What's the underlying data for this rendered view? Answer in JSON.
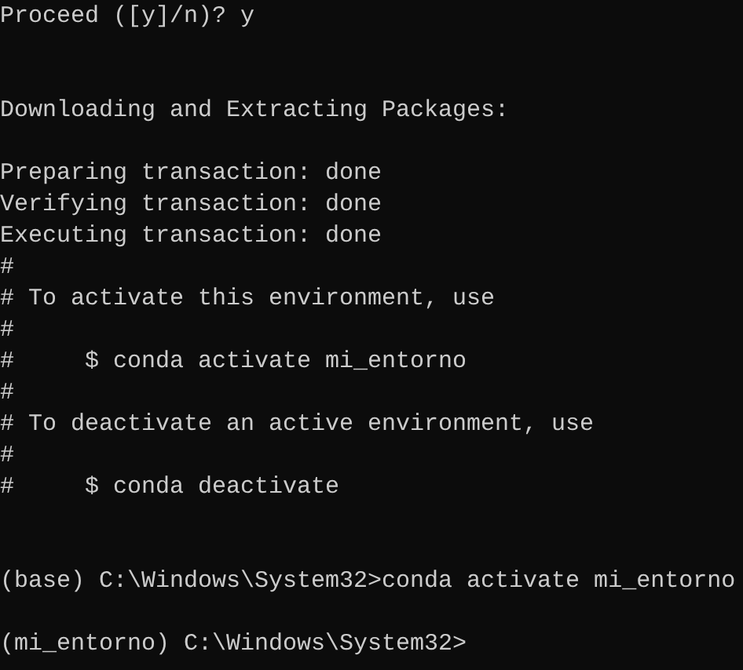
{
  "terminal": {
    "lines": [
      {
        "kind": "output",
        "text": "Proceed ([y]/n)? y"
      },
      {
        "kind": "blank"
      },
      {
        "kind": "blank"
      },
      {
        "kind": "output",
        "text": "Downloading and Extracting Packages:"
      },
      {
        "kind": "blank"
      },
      {
        "kind": "output",
        "text": "Preparing transaction: done"
      },
      {
        "kind": "output",
        "text": "Verifying transaction: done"
      },
      {
        "kind": "output",
        "text": "Executing transaction: done"
      },
      {
        "kind": "comment",
        "text": "#"
      },
      {
        "kind": "comment",
        "text": "# To activate this environment, use"
      },
      {
        "kind": "comment",
        "text": "#"
      },
      {
        "kind": "comment",
        "text": "#     $ conda activate mi_entorno"
      },
      {
        "kind": "comment",
        "text": "#"
      },
      {
        "kind": "comment",
        "text": "# To deactivate an active environment, use"
      },
      {
        "kind": "comment",
        "text": "#"
      },
      {
        "kind": "comment",
        "text": "#     $ conda deactivate"
      },
      {
        "kind": "blank"
      },
      {
        "kind": "blank"
      },
      {
        "kind": "prompt",
        "text": "(base) C:\\Windows\\System32>conda activate mi_entorno"
      },
      {
        "kind": "blank"
      },
      {
        "kind": "prompt",
        "text": "(mi_entorno) C:\\Windows\\System32>"
      }
    ]
  }
}
